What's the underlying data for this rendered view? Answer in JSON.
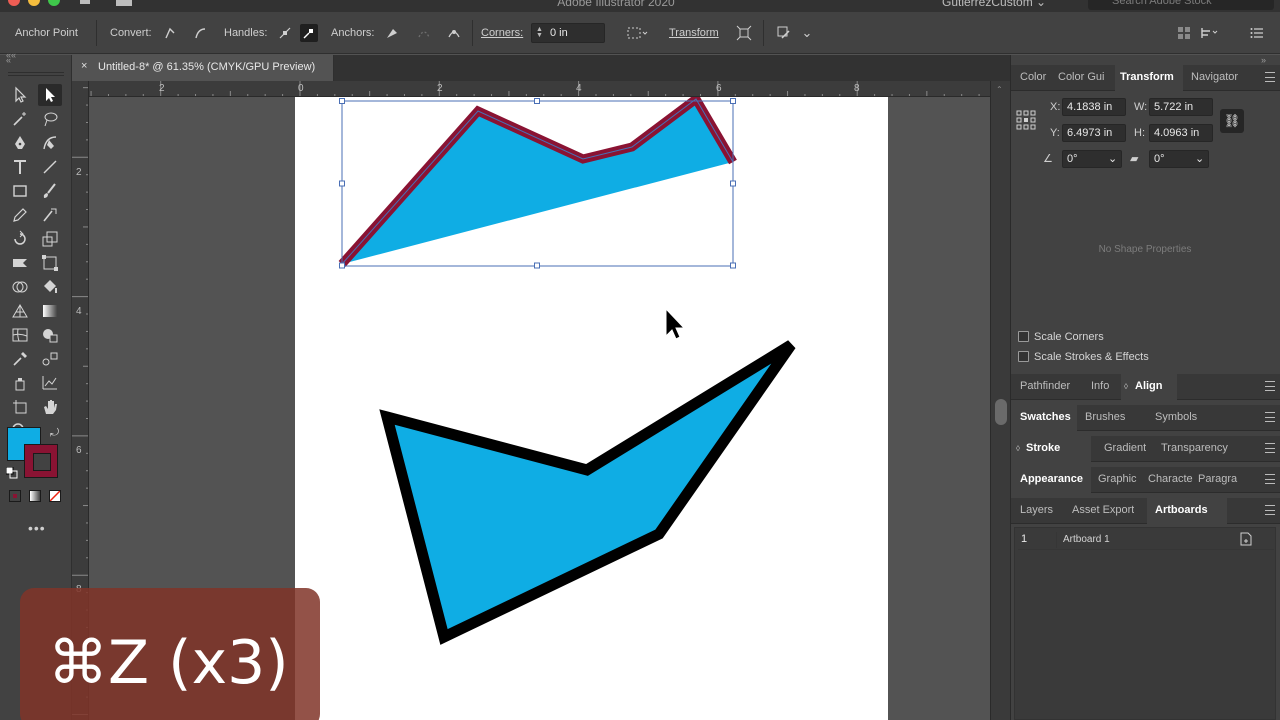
{
  "window": {
    "title": "Adobe Illustrator 2020",
    "workspace": "GutierrezCustom",
    "search_placeholder": "Search Adobe Stock"
  },
  "control_bar": {
    "tool_name": "Anchor Point",
    "convert_label": "Convert:",
    "handles_label": "Handles:",
    "anchors_label": "Anchors:",
    "corners_label": "Corners:",
    "corners_value": "0 in",
    "transform_label": "Transform"
  },
  "document": {
    "tab_title": "Untitled-8* @ 61.35% (CMYK/GPU Preview)",
    "close_glyph": "×"
  },
  "rulers": {
    "top": [
      "2",
      "0",
      "2",
      "4",
      "6",
      "8"
    ],
    "left": [
      "2",
      "4",
      "6",
      "8"
    ]
  },
  "panels": {
    "group1_tabs": [
      "Color",
      "Color Gui",
      "Transform",
      "Navigator"
    ],
    "transform": {
      "x_label": "X:",
      "x_value": "4.1838 in",
      "y_label": "Y:",
      "y_value": "6.4973 in",
      "w_label": "W:",
      "w_value": "5.722 in",
      "h_label": "H:",
      "h_value": "4.0963 in",
      "angle_value": "0°",
      "shear_value": "0°",
      "no_shape": "No Shape Properties",
      "scale_corners": "Scale Corners",
      "scale_strokes": "Scale Strokes & Effects"
    },
    "group2_tabs": [
      "Pathfinder",
      "Info",
      "Align"
    ],
    "group3_tabs": [
      "Swatches",
      "Brushes",
      "Symbols"
    ],
    "group4_tabs": [
      "Stroke",
      "Gradient",
      "Transparency"
    ],
    "group5_tabs": [
      "Appearance",
      "Graphic",
      "Characte",
      "Paragra"
    ],
    "group6_tabs": [
      "Layers",
      "Asset Export",
      "Artboards"
    ],
    "artboards": [
      {
        "num": "1",
        "name": "Artboard 1"
      }
    ]
  },
  "colors": {
    "fill": "#0fade4",
    "stroke_crimson": "#8a1333",
    "selection": "#4a6fb5"
  },
  "overlay": {
    "shortcut_text": "⌘Z (x3)"
  }
}
